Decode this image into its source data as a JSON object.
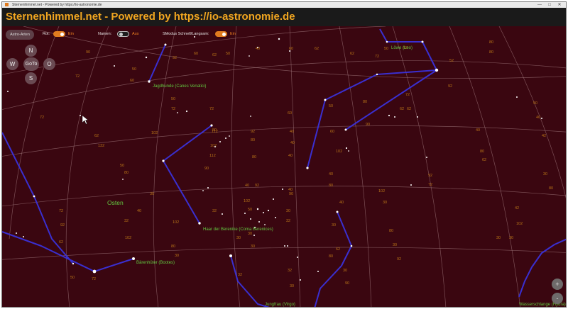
{
  "window": {
    "title": "Sternenhimmel.net - Powered by https://io-astronomie.de",
    "controls": [
      "—",
      "□",
      "✕"
    ]
  },
  "header": {
    "title": "Sternenhimmel.net - Powered by https://io-astronomie.de"
  },
  "toolbar": {
    "astro_button": "Astro-Arten",
    "rot_label": "Rot:",
    "rot_state": "Ein",
    "namen_label": "Namen:",
    "namen_state": "Aus",
    "modus_label": "SModus Schnell/Langsam:",
    "modus_state": "Ein"
  },
  "navigation": {
    "north": "N",
    "west": "W",
    "goto": "GoTo",
    "east": "O",
    "south": "S"
  },
  "zoom": {
    "in": "+",
    "out": "-"
  },
  "constellations": {
    "canes_venatici": "Jagdhunde (Canes Venatici)",
    "leo": "Löwe (Leo)",
    "coma": "Haar der Berenike (Coma Berenices)",
    "bootes": "Bärenhüter (Bootes)",
    "virgo": "Jungfrau (Virgo)",
    "hydra": "Wasserschlange (Hydra)"
  },
  "direction_label": "Osten",
  "grid_numbers": [
    "90",
    "72",
    "50",
    "60",
    "92",
    "60",
    "62",
    "50",
    "40",
    "60",
    "62",
    "62",
    "72",
    "50",
    "92",
    "52",
    "80",
    "80",
    "92",
    "72",
    "80",
    "62",
    "50",
    "40",
    "72",
    "62",
    "50",
    "72",
    "72",
    "92",
    "80",
    "60",
    "50",
    "60",
    "90",
    "62",
    "40",
    "80",
    "42",
    "92",
    "72",
    "40",
    "40",
    "40",
    "80",
    "102",
    "30",
    "72",
    "92",
    "102",
    "102",
    "102",
    "80",
    "80",
    "40",
    "102",
    "62",
    "40",
    "40",
    "90",
    "32",
    "80",
    "32",
    "50",
    "30",
    "30",
    "40",
    "42",
    "102",
    "80",
    "30",
    "92",
    "80",
    "62",
    "30",
    "90",
    "32",
    "30",
    "30",
    "32",
    "80",
    "30",
    "62",
    "50",
    "72",
    "40",
    "90",
    "30",
    "30",
    "32",
    "30",
    "112",
    "102",
    "50",
    "132",
    "102",
    "30",
    "80",
    "30",
    "30",
    "112",
    "92",
    "92"
  ],
  "colors": {
    "sky": "#3a0610",
    "constellation_line": "#3a2fd0",
    "label_green": "#62c840",
    "grid_number": "#b87418",
    "accent": "#e07b1f"
  }
}
